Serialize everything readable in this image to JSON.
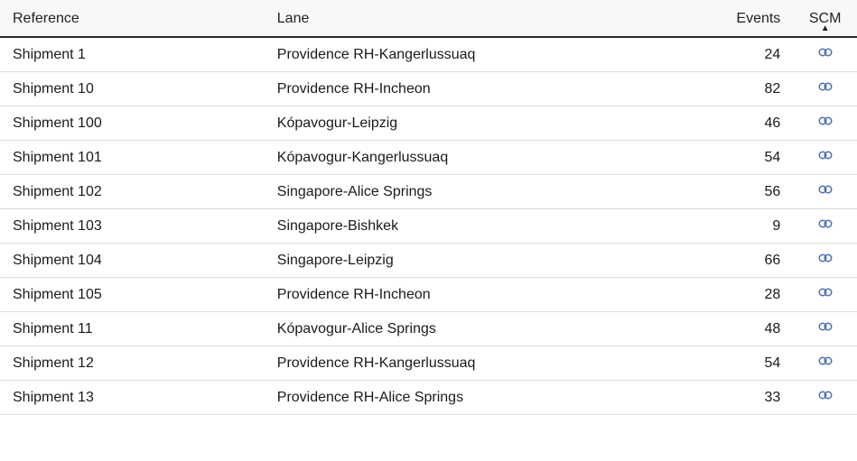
{
  "columns": {
    "reference": "Reference",
    "lane": "Lane",
    "events": "Events",
    "scm": "SCM"
  },
  "sort": {
    "column": "scm",
    "direction": "asc",
    "glyph": "▲"
  },
  "icons": {
    "link": "link-icon"
  },
  "rows": [
    {
      "reference": "Shipment 1",
      "lane": "Providence RH-Kangerlussuaq",
      "events": 24
    },
    {
      "reference": "Shipment 10",
      "lane": "Providence RH-Incheon",
      "events": 82
    },
    {
      "reference": "Shipment 100",
      "lane": "Kópavogur-Leipzig",
      "events": 46
    },
    {
      "reference": "Shipment 101",
      "lane": "Kópavogur-Kangerlussuaq",
      "events": 54
    },
    {
      "reference": "Shipment 102",
      "lane": "Singapore-Alice Springs",
      "events": 56
    },
    {
      "reference": "Shipment 103",
      "lane": "Singapore-Bishkek",
      "events": 9
    },
    {
      "reference": "Shipment 104",
      "lane": "Singapore-Leipzig",
      "events": 66
    },
    {
      "reference": "Shipment 105",
      "lane": "Providence RH-Incheon",
      "events": 28
    },
    {
      "reference": "Shipment 11",
      "lane": "Kópavogur-Alice Springs",
      "events": 48
    },
    {
      "reference": "Shipment 12",
      "lane": "Providence RH-Kangerlussuaq",
      "events": 54
    },
    {
      "reference": "Shipment 13",
      "lane": "Providence RH-Alice Springs",
      "events": 33
    }
  ]
}
